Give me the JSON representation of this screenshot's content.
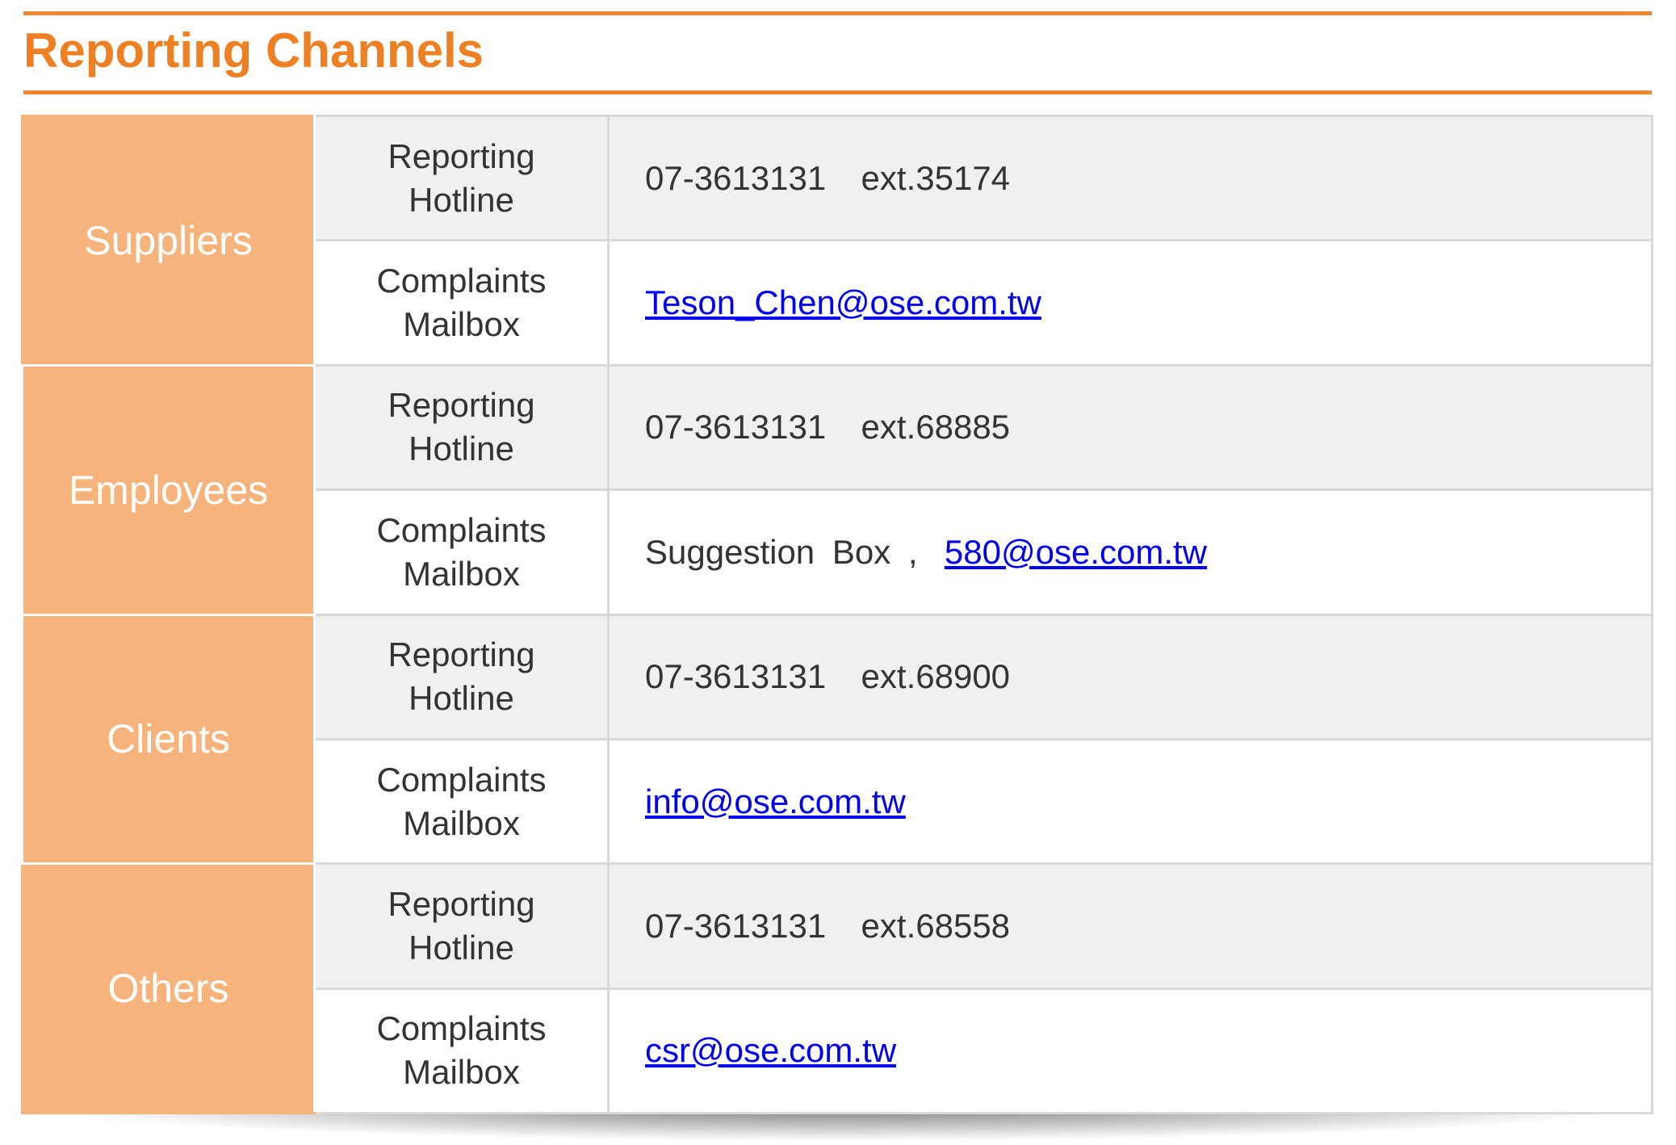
{
  "title": "Reporting Channels",
  "labels": {
    "hotline_line1": "Reporting",
    "hotline_line2": "Hotline",
    "mailbox_line1": "Complaints",
    "mailbox_line2": "Mailbox"
  },
  "groups": [
    {
      "name": "Suppliers",
      "hotline": "07-3613131  ext.35174",
      "mailbox_prefix": "",
      "mailbox_email": "Teson_Chen@ose.com.tw"
    },
    {
      "name": "Employees",
      "hotline": "07-3613131  ext.68885",
      "mailbox_prefix": "Suggestion Box ,",
      "mailbox_email": "580@ose.com.tw"
    },
    {
      "name": "Clients",
      "hotline": "07-3613131  ext.68900",
      "mailbox_prefix": "",
      "mailbox_email": "info@ose.com.tw"
    },
    {
      "name": "Others",
      "hotline": "07-3613131  ext.68558",
      "mailbox_prefix": "",
      "mailbox_email": "csr@ose.com.tw"
    }
  ],
  "colors": {
    "accent": "#ee7f22",
    "group_fill": "#f6b47c",
    "row_shade": "#f0f0f0",
    "link": "#0000ee"
  }
}
